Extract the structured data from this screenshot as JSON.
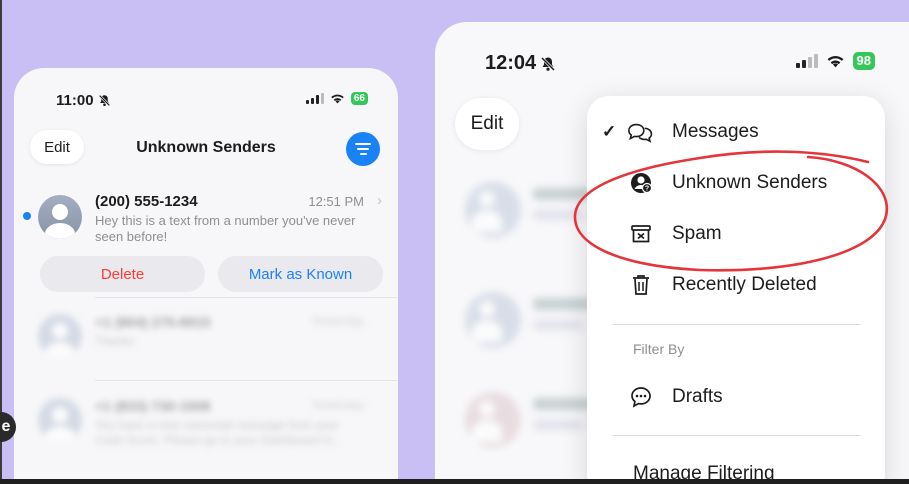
{
  "left_phone": {
    "time": "11:00",
    "battery": "66",
    "edit_label": "Edit",
    "title": "Unknown Senders",
    "message": {
      "name": "(200) 555-1234",
      "time": "12:51 PM",
      "preview": "Hey this is a text from a number you've never seen before!"
    },
    "delete_label": "Delete",
    "mark_known_label": "Mark as Known",
    "blurred_rows": [
      {
        "title": "+1 (804) 275-8915",
        "date": "Yesterday",
        "subtitle": "Thanks"
      },
      {
        "title": "+1 (833) 730-1508",
        "date": "Yesterday",
        "subtitle": "You have a new voicemail message from your Cash Score. Please go to your Dashboard in..."
      }
    ]
  },
  "right_phone": {
    "time": "12:04",
    "battery": "98",
    "edit_label": "Edit",
    "menu": {
      "items": [
        {
          "label": "Messages",
          "checked": true,
          "icon": "messages-bubbles-icon"
        },
        {
          "label": "Unknown Senders",
          "checked": false,
          "icon": "unknown-person-icon"
        },
        {
          "label": "Spam",
          "checked": false,
          "icon": "spam-box-icon"
        },
        {
          "label": "Recently Deleted",
          "checked": false,
          "icon": "trash-icon"
        }
      ],
      "check_mark": "✓",
      "filter_by_label": "Filter By",
      "filter_items": [
        {
          "label": "Drafts",
          "icon": "drafts-bubble-icon"
        }
      ],
      "manage_filtering_label": "Manage Filtering"
    }
  },
  "accent_colors": {
    "background": "#c9bff5",
    "blue": "#1a82f7",
    "red_action": "#ff3b30",
    "annotation_red": "#e5343a",
    "battery_green": "#34c759"
  }
}
